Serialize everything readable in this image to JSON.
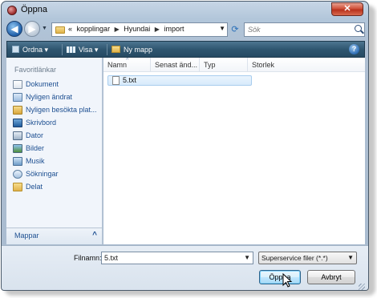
{
  "window": {
    "title": "Öppna",
    "close_label": "✕"
  },
  "address_bar": {
    "chevron": "«",
    "breadcrumbs": [
      "kopplingar",
      "Hyundai",
      "import"
    ],
    "search_placeholder": "Sök"
  },
  "toolbar": {
    "organize_label": "Ordna",
    "view_label": "Visa",
    "new_folder_label": "Ny mapp",
    "help_label": "?"
  },
  "navigation": {
    "header": "Favoritlänkar",
    "items": [
      {
        "label": "Dokument",
        "icon": "documents-icon"
      },
      {
        "label": "Nyligen ändrat",
        "icon": "recently-changed-icon"
      },
      {
        "label": "Nyligen besökta plat...",
        "icon": "recent-places-icon"
      },
      {
        "label": "Skrivbord",
        "icon": "desktop-icon"
      },
      {
        "label": "Dator",
        "icon": "computer-icon"
      },
      {
        "label": "Bilder",
        "icon": "pictures-icon"
      },
      {
        "label": "Musik",
        "icon": "music-icon"
      },
      {
        "label": "Sökningar",
        "icon": "searches-icon"
      },
      {
        "label": "Delat",
        "icon": "shared-folder-icon"
      }
    ],
    "footer_label": "Mappar",
    "footer_chevron": "^"
  },
  "file_list": {
    "columns": [
      "Namn",
      "Senast änd...",
      "Typ",
      "Storlek"
    ],
    "files": [
      {
        "name": "5.txt"
      }
    ]
  },
  "bottom_bar": {
    "filename_label": "Filnamn:",
    "filename_value": "5.txt",
    "filetype_value": "Superservice filer (*.*)",
    "open_label": "Öppna",
    "cancel_label": "Avbryt"
  },
  "colors": {
    "toolbar_bg": "#2f5670",
    "link_text": "#1d4f91",
    "close_button": "#d0513a",
    "selection": "#d7eafb"
  }
}
